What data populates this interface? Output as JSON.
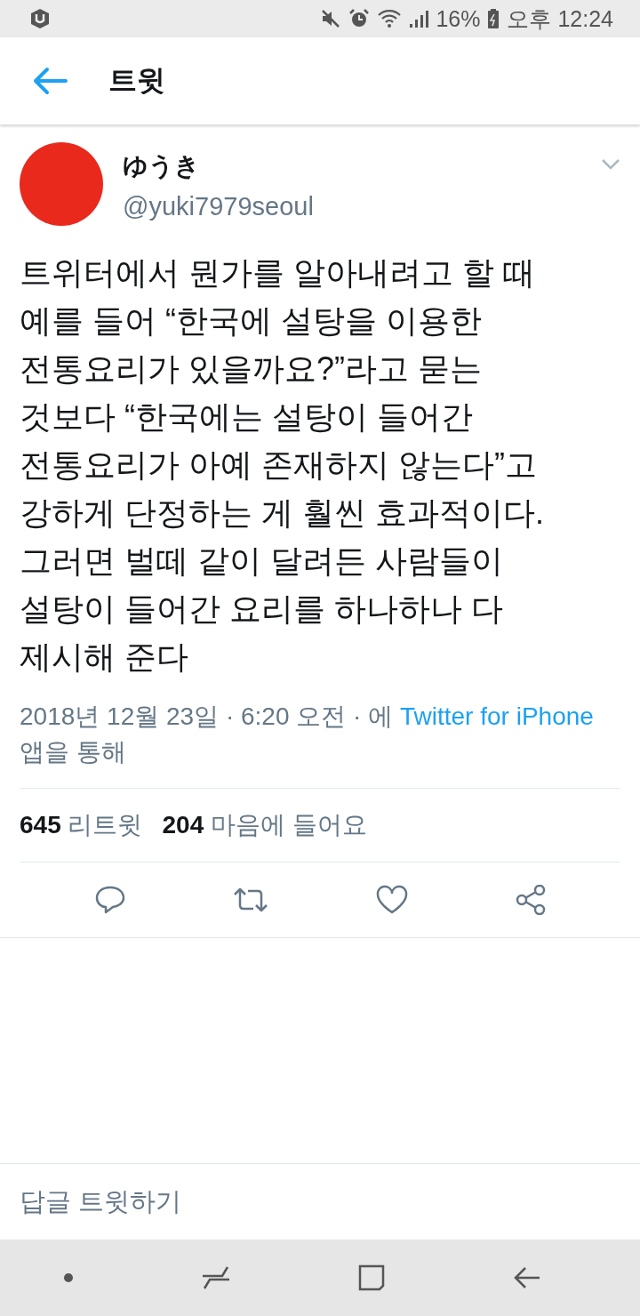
{
  "status_bar": {
    "battery": "16%",
    "time": "오후 12:24"
  },
  "header": {
    "title": "트윗"
  },
  "tweet": {
    "author": {
      "name": "ゆうき",
      "handle": "@yuki7979seoul"
    },
    "body_lines": [
      "트위터에서 뭔가를 알아내려고 할 때",
      "예를 들어 “한국에 설탕을 이용한",
      "전통요리가 있을까요?”라고 묻는",
      "것보다 “한국에는 설탕이 들어간",
      "전통요리가 아예 존재하지 않는다”고",
      "강하게 단정하는 게 훨씬 효과적이다.",
      "그러면 벌떼 같이 달려든 사람들이",
      "설탕이 들어간 요리를 하나하나 다",
      "제시해 준다"
    ],
    "meta": {
      "prefix": "2018년 12월 23일 · 6:20 오전 · 에 ",
      "source": "Twitter for iPhone",
      "suffix": " 앱을 통해"
    },
    "stats": [
      {
        "count": "645",
        "label": "리트윗"
      },
      {
        "count": "204",
        "label": "마음에 들어요"
      }
    ]
  },
  "reply": {
    "placeholder": "답글 트윗하기"
  }
}
